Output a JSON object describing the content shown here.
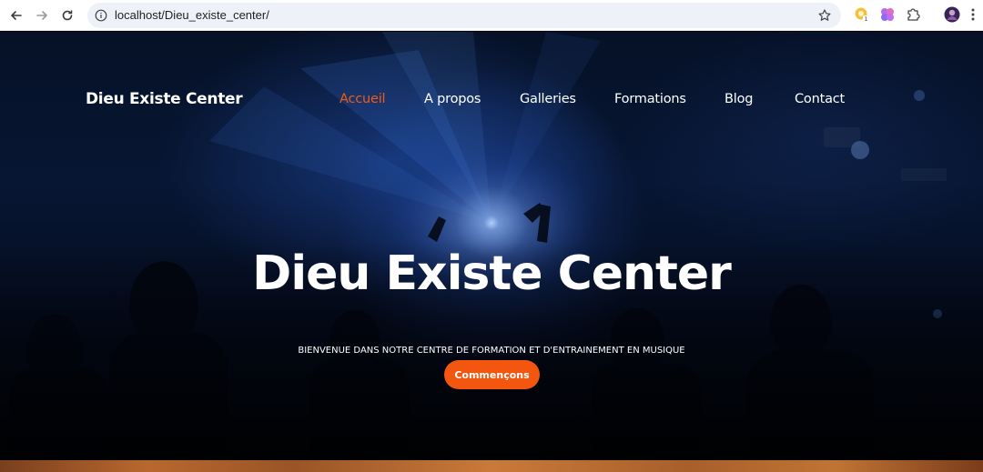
{
  "browser": {
    "url": "localhost/Dieu_existe_center/",
    "back_icon": "arrow-left-icon",
    "forward_icon": "arrow-right-icon",
    "reload_icon": "reload-icon",
    "bookmark_icon": "star-icon",
    "extensions": [
      "extension-yellow-icon",
      "extension-purple-icon",
      "puzzle-icon"
    ],
    "profile_icon": "avatar",
    "menu_icon": "kebab-icon"
  },
  "site": {
    "brand": "Dieu Existe Center",
    "nav": [
      {
        "label": "Accueil",
        "active": true
      },
      {
        "label": "A propos",
        "active": false
      },
      {
        "label": "Galleries",
        "active": false
      },
      {
        "label": "Formations",
        "active": false
      },
      {
        "label": "Blog",
        "active": false
      },
      {
        "label": "Contact",
        "active": false
      }
    ],
    "hero": {
      "title": "Dieu Existe Center",
      "subtitle": "BIENVENUE DANS NOTRE CENTRE DE FORMATION ET D'ENTRAINEMENT EN MUSIQUE",
      "cta": "Commençons"
    }
  },
  "colors": {
    "accent": "#f25a14",
    "hero_background": "#061127"
  }
}
